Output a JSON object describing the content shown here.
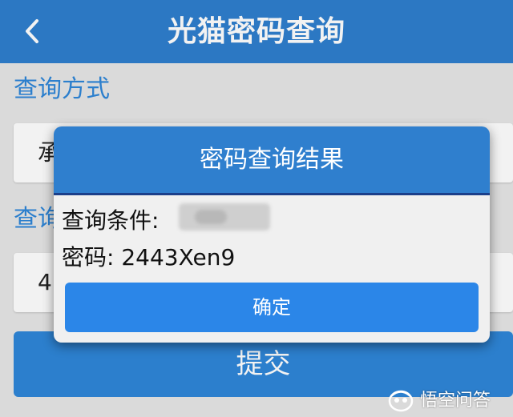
{
  "header": {
    "title": "光猫密码查询",
    "back_icon": "chevron-left-icon"
  },
  "form": {
    "method_label": "查询方式",
    "method_value_partial": "承",
    "condition_label_partial": "查询",
    "condition_value_partial": "4",
    "submit_label": "提交"
  },
  "dialog": {
    "title": "密码查询结果",
    "condition_label": "查询条件:",
    "password_label": "密码:",
    "password_value": "2443Xen9",
    "confirm_label": "确定"
  },
  "watermark": {
    "text": "悟空问答",
    "icon": "wukong-logo-icon"
  },
  "colors": {
    "header_blue": "#2f7fce",
    "label_blue": "#2f86d8",
    "button_blue": "#2b86e8",
    "background": "#e6e6e6"
  }
}
